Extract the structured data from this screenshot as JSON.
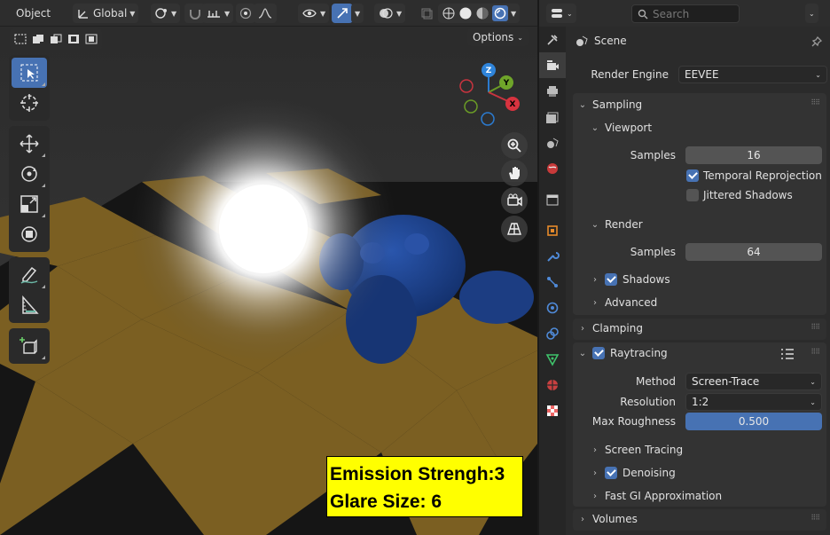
{
  "viewport": {
    "mode_label": "Object",
    "transform_orientation": "Global",
    "options_label": "Options",
    "overlay_text": {
      "line1": "Emission Strengh:3",
      "line2": "Glare Size: 6"
    },
    "gizmo_axes": [
      "Z",
      "Y",
      "X"
    ],
    "scene_colors": {
      "floor_dark": "#141414",
      "floor_light": "#7d6223",
      "light": "#ffffff",
      "monkey": "#1d3f86",
      "overlay_bg": "#ffff00"
    },
    "toolbar_tools": [
      "select-box",
      "cursor",
      "move",
      "rotate",
      "scale",
      "transform",
      "annotate",
      "measure",
      "add-cube"
    ]
  },
  "properties": {
    "search_placeholder": "Search",
    "context": "Scene",
    "render_engine_label": "Render Engine",
    "render_engine_value": "EEVEE",
    "sampling": {
      "title": "Sampling",
      "viewport": {
        "title": "Viewport",
        "samples_label": "Samples",
        "samples_value": "16",
        "temporal_reprojection": "Temporal Reprojection",
        "temporal_reprojection_checked": true,
        "jittered_shadows": "Jittered Shadows",
        "jittered_shadows_checked": false
      },
      "render": {
        "title": "Render",
        "samples_label": "Samples",
        "samples_value": "64"
      },
      "shadows": "Shadows",
      "shadows_checked": true,
      "advanced": "Advanced"
    },
    "clamping": "Clamping",
    "raytracing": {
      "title": "Raytracing",
      "checked": true,
      "method_label": "Method",
      "method_value": "Screen-Trace",
      "resolution_label": "Resolution",
      "resolution_value": "1:2",
      "max_roughness_label": "Max Roughness",
      "max_roughness_value": "0.500",
      "screen_tracing": "Screen Tracing",
      "denoising": "Denoising",
      "denoising_checked": true,
      "fast_gi": "Fast GI Approximation"
    },
    "volumes": "Volumes"
  }
}
